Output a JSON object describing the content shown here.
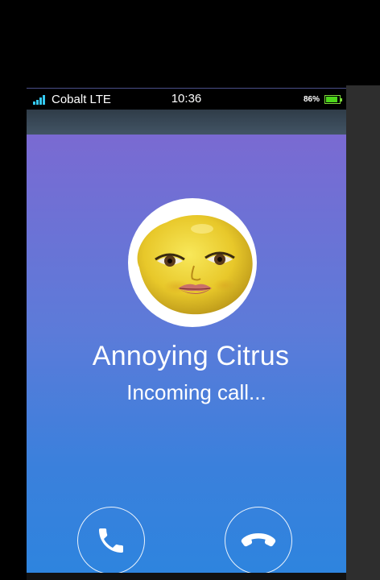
{
  "status_bar": {
    "carrier": "Cobalt LTE",
    "time": "10:36",
    "battery_percent": "86%",
    "battery_level": 0.86,
    "signal_bars": 4
  },
  "call": {
    "contact_name": "Annoying Citrus",
    "status": "Incoming call...",
    "avatar": "lemon-face-photo"
  },
  "actions": {
    "answer_icon": "phone-answer-icon",
    "decline_icon": "phone-hangup-icon"
  },
  "colors": {
    "gradient_top": "#7a6ad2",
    "gradient_bottom": "#2e84de",
    "battery_green": "#4cd61a",
    "signal_blue": "#34c8f0"
  }
}
